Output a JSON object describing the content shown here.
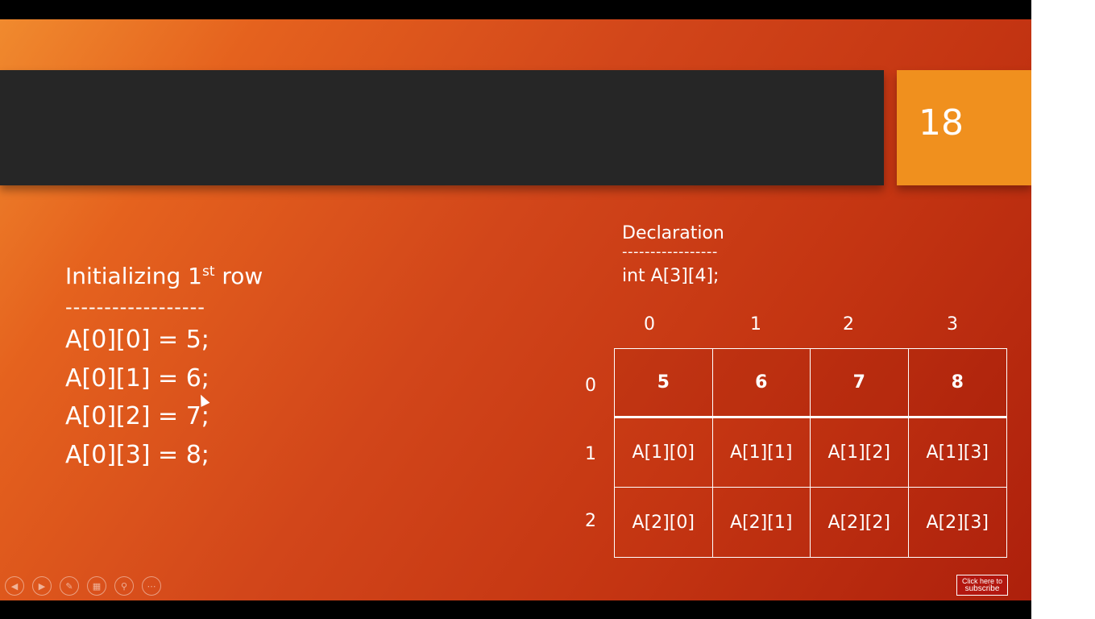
{
  "slide": {
    "number": "18",
    "left": {
      "heading_text": "Initializing 1",
      "heading_sup": "st",
      "heading_tail": " row",
      "dashes": "------------------",
      "lines": [
        "A[0][0] = 5;",
        "A[0][1] = 6;",
        "A[0][2] = 7;",
        "A[0][3] = 8;"
      ]
    },
    "declaration": {
      "title": "Declaration",
      "dashes": "-----------------",
      "code": "int A[3][4];"
    },
    "array": {
      "col_indices": [
        "0",
        "1",
        "2",
        "3"
      ],
      "row_indices": [
        "0",
        "1",
        "2"
      ],
      "rows": [
        [
          "5",
          "6",
          "7",
          "8"
        ],
        [
          "A[1][0]",
          "A[1][1]",
          "A[1][2]",
          "A[1][3]"
        ],
        [
          "A[2][0]",
          "A[2][1]",
          "A[2][2]",
          "A[2][3]"
        ]
      ]
    }
  },
  "controls": {
    "prev_icon": "◀",
    "next_icon": "▶",
    "pen_icon": "✎",
    "slides_icon": "▦",
    "zoom_icon": "⚲",
    "more_icon": "⋯"
  },
  "subscribe": {
    "line1": "Click here to",
    "line2": "subscribe"
  },
  "colors": {
    "title_bar": "#262626",
    "number_box": "#f0901e",
    "slide_gradient_start": "#f08a2e",
    "slide_gradient_end": "#ad200c"
  }
}
